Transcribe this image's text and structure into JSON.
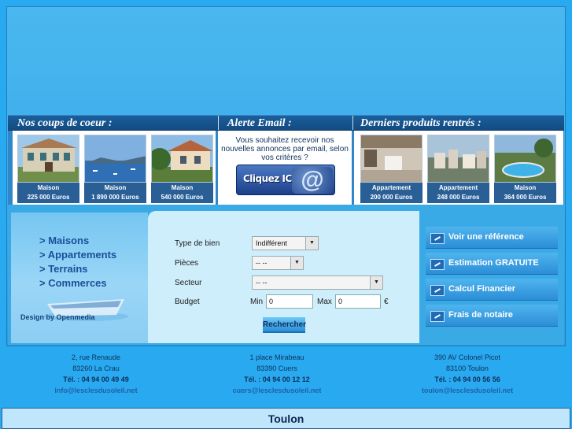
{
  "colors": {
    "page_bg": "#29aaf0",
    "header_bar": "#1b5f9e",
    "card_label_bg": "#2a5f96",
    "search_panel_bg": "#cfeefc",
    "action_button": "#2c8dd7"
  },
  "header": {
    "coups": "Nos coups de coeur :",
    "alerte": "Alerte Email :",
    "derniers": "Derniers produits rentrés :"
  },
  "coups_de_coeur": [
    {
      "type": "Maison",
      "price": "225 000 Euros"
    },
    {
      "type": "Maison",
      "price": "1 890 000 Euros"
    },
    {
      "type": "Maison",
      "price": "540 000 Euros"
    }
  ],
  "alert": {
    "text": "Vous souhaitez recevoir nos nouvelles annonces par email, selon vos critères ?",
    "button": "Cliquez ICI",
    "button_icon": "at-icon"
  },
  "derniers_produits": [
    {
      "type": "Appartement",
      "price": "200 000 Euros"
    },
    {
      "type": "Appartement",
      "price": "248 000 Euros"
    },
    {
      "type": "Maison",
      "price": "364 000 Euros"
    }
  ],
  "menu": {
    "items": [
      "> Maisons",
      "> Appartements",
      "> Terrains",
      "> Commerces"
    ],
    "credit": "Design by Openmedia"
  },
  "search": {
    "type_label": "Type de bien",
    "type_value": "Indifférent",
    "pieces_label": "Pièces",
    "pieces_value": "-- --",
    "secteur_label": "Secteur",
    "secteur_value": "-- --",
    "budget_label": "Budget",
    "min_label": "Min",
    "min_value": "0",
    "max_label": "Max",
    "max_value": "0",
    "currency": "€",
    "button": "Rechercher"
  },
  "actions": [
    "Voir une référence",
    "Estimation GRATUITE",
    "Calcul Financier",
    "Frais de notaire"
  ],
  "agencies": [
    {
      "street": "2, rue Renaude",
      "city": "83260 La Crau",
      "tel": "Tél. : 04 94 00 49 49",
      "email": "info@lesclesdusoleil.net"
    },
    {
      "street": "1 place Mirabeau",
      "city": "83390 Cuers",
      "tel": "Tél. : 04 94 00 12 12",
      "email": "cuers@lesclesdusoleil.net"
    },
    {
      "street": "390 AV Colonel Picot",
      "city": "83100 Toulon",
      "tel": "Tél. : 04 94 00 56 56",
      "email": "toulon@lesclesdusoleil.net"
    }
  ],
  "bottom": {
    "title": "Toulon"
  }
}
